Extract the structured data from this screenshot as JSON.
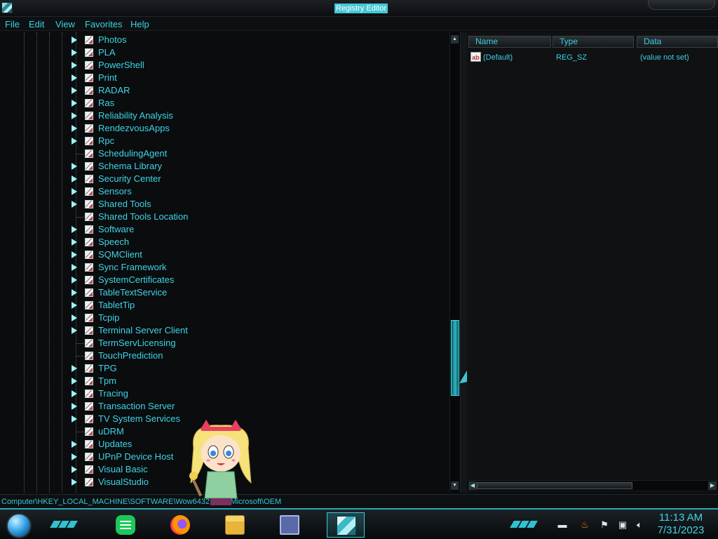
{
  "window": {
    "title": "Registry Editor"
  },
  "menu": [
    "File",
    "Edit",
    "View",
    "Favorites",
    "Help"
  ],
  "tree": {
    "items": [
      {
        "label": "Photos",
        "expandable": true
      },
      {
        "label": "PLA",
        "expandable": true
      },
      {
        "label": "PowerShell",
        "expandable": true
      },
      {
        "label": "Print",
        "expandable": true
      },
      {
        "label": "RADAR",
        "expandable": true
      },
      {
        "label": "Ras",
        "expandable": true
      },
      {
        "label": "Reliability Analysis",
        "expandable": true
      },
      {
        "label": "RendezvousApps",
        "expandable": true
      },
      {
        "label": "Rpc",
        "expandable": true
      },
      {
        "label": "SchedulingAgent",
        "expandable": false
      },
      {
        "label": "Schema Library",
        "expandable": true
      },
      {
        "label": "Security Center",
        "expandable": true
      },
      {
        "label": "Sensors",
        "expandable": true
      },
      {
        "label": "Shared Tools",
        "expandable": true
      },
      {
        "label": "Shared Tools Location",
        "expandable": false
      },
      {
        "label": "Software",
        "expandable": true
      },
      {
        "label": "Speech",
        "expandable": true
      },
      {
        "label": "SQMClient",
        "expandable": true
      },
      {
        "label": "Sync Framework",
        "expandable": true
      },
      {
        "label": "SystemCertificates",
        "expandable": true
      },
      {
        "label": "TableTextService",
        "expandable": true
      },
      {
        "label": "TabletTip",
        "expandable": true
      },
      {
        "label": "Tcpip",
        "expandable": true
      },
      {
        "label": "Terminal Server Client",
        "expandable": true
      },
      {
        "label": "TermServLicensing",
        "expandable": false
      },
      {
        "label": "TouchPrediction",
        "expandable": false
      },
      {
        "label": "TPG",
        "expandable": true
      },
      {
        "label": "Tpm",
        "expandable": true
      },
      {
        "label": "Tracing",
        "expandable": true
      },
      {
        "label": "Transaction Server",
        "expandable": true
      },
      {
        "label": "TV System Services",
        "expandable": true
      },
      {
        "label": "uDRM",
        "expandable": false
      },
      {
        "label": "Updates",
        "expandable": true
      },
      {
        "label": "UPnP Device Host",
        "expandable": true
      },
      {
        "label": "Visual Basic",
        "expandable": true
      },
      {
        "label": "VisualStudio",
        "expandable": true
      }
    ]
  },
  "list": {
    "columns": [
      "Name",
      "Type",
      "Data"
    ],
    "rows": [
      {
        "icon": "string-value-icon",
        "icon_text": "ab",
        "name": "(Default)",
        "type": "REG_SZ",
        "data": "(value not set)"
      }
    ]
  },
  "statusbar": {
    "path": "Computer\\HKEY_LOCAL_MACHINE\\SOFTWARE\\Wow6432Node\\Microsoft\\OEM"
  },
  "taskbar": {
    "apps": [
      {
        "name": "notes-app",
        "icon": "notes-icon",
        "active": false
      },
      {
        "name": "firefox",
        "icon": "firefox-icon",
        "active": false
      },
      {
        "name": "file-explorer",
        "icon": "folder-icon",
        "active": false
      },
      {
        "name": "window-app",
        "icon": "window-icon",
        "active": false
      },
      {
        "name": "registry-editor",
        "icon": "regedit-icon",
        "active": true
      }
    ],
    "tray_icons": [
      "keyboard-icon",
      "java-icon",
      "flag-icon",
      "network-icon",
      "volume-icon"
    ],
    "clock": {
      "time": "11:13 AM",
      "date": "7/31/2023"
    }
  },
  "colors": {
    "accent": "#35d0e0",
    "background": "#0a0c0e",
    "selected_title_bg": "#44c8d6"
  }
}
